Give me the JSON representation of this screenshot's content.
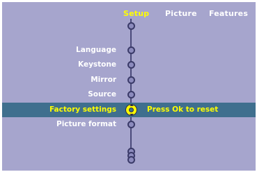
{
  "tabs": [
    {
      "label": "Setup",
      "active": true
    },
    {
      "label": "Picture",
      "active": false
    },
    {
      "label": "Features",
      "active": false
    }
  ],
  "menu": {
    "items": [
      {
        "label": "Language"
      },
      {
        "label": "Keystone"
      },
      {
        "label": "Mirror"
      },
      {
        "label": "Source"
      },
      {
        "label": "Factory settings",
        "selected": true
      },
      {
        "label": "Picture format"
      }
    ],
    "selected_hint": "Press Ok to reset"
  },
  "colors": {
    "background": "#a6a5cd",
    "highlight": "#3f6f8e",
    "active_text": "#ffff00",
    "text": "#ffffff"
  },
  "icons": {
    "node": "circle-node-icon",
    "selected_node": "up-down-selector-icon",
    "scroll": "scroll-more-icon"
  }
}
